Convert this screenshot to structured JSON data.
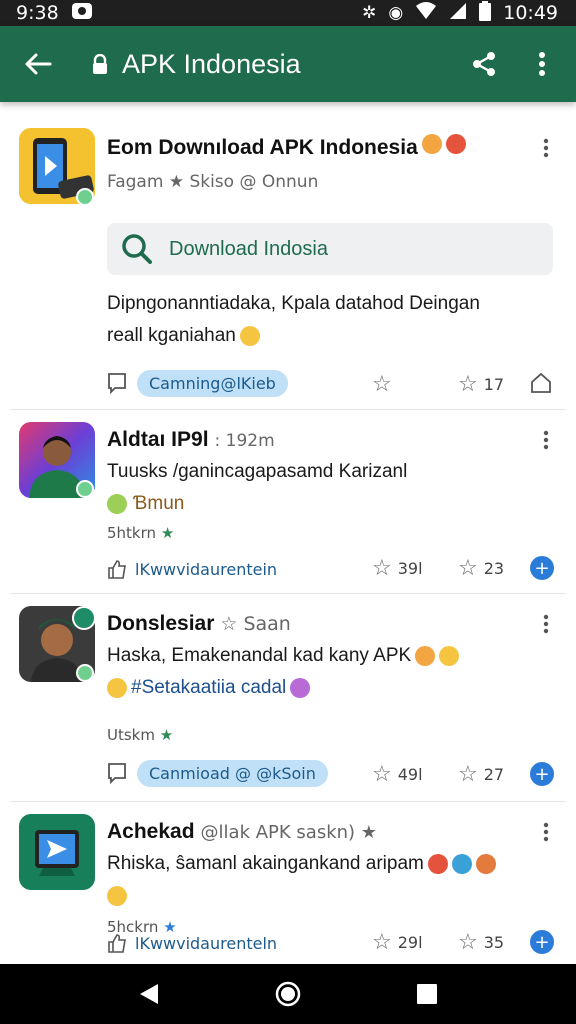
{
  "status": {
    "time_left": "9:38",
    "time_right": "10:49"
  },
  "appbar": {
    "title": "APK Indonesia"
  },
  "posts": [
    {
      "author": "Eom Downıload APK Indonesia",
      "meta": "Fagam ★ Skiso @ Onnun",
      "search_label": "Download Indosia",
      "text1": "Dipngonanntiadaka, Kpala datahod Deingan",
      "text2": "reall kganiahan",
      "pill": "Camning@lKieb",
      "count_star": "17"
    },
    {
      "author": "Aldtaı IP9l",
      "meta": ": 192m",
      "text1": "Tuusks /ganincagapasamd Karizanl",
      "text2": "Ɓmun",
      "small": "5htkrn",
      "link": "lKwwvidaurentein",
      "count_a": "39l",
      "count_b": "23"
    },
    {
      "author": "Donslesiar",
      "meta": "☆ Saan",
      "text1": "Haska, Emakenandal kad kany APK",
      "text2": "#Setakaatiia cadal",
      "small": "Utskm",
      "pill": "Canmioad @ @kSoin",
      "count_a": "49l",
      "count_b": "27"
    },
    {
      "author": "Achekad",
      "meta": "@llak APK saskn) ★",
      "text1": "Rhiska, ŝamanl akaingankand aripam",
      "small": "5hckrn",
      "link": "lKwwvidaurenteln",
      "count_a": "29l",
      "count_b": "35"
    }
  ],
  "colors": {
    "appbar": "#1e6b4d",
    "accent_blue": "#2b7bd8",
    "pill_bg": "#bfe0f7"
  }
}
